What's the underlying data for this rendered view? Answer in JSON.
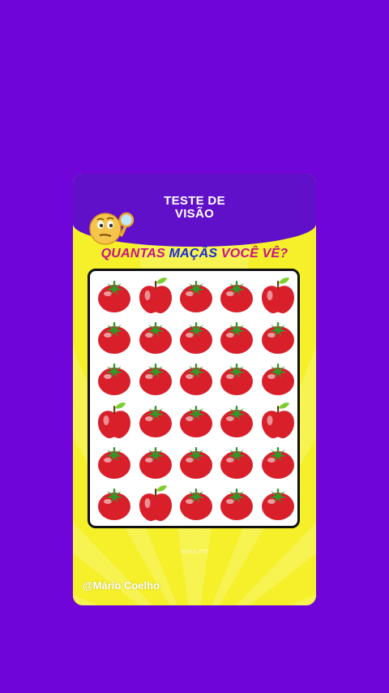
{
  "header": {
    "line1": "TESTE DE",
    "line2": "VISÃO"
  },
  "question": {
    "part1": "QUANTAS ",
    "part2": "MAÇÃS",
    "part3": " VOCÊ VÊ?"
  },
  "grid": {
    "rows": [
      [
        "tomato",
        "apple",
        "tomato",
        "tomato",
        "apple"
      ],
      [
        "tomato",
        "tomato",
        "tomato",
        "tomato",
        "tomato"
      ],
      [
        "tomato",
        "tomato",
        "tomato",
        "tomato",
        "tomato"
      ],
      [
        "apple",
        "tomato",
        "tomato",
        "tomato",
        "apple"
      ],
      [
        "tomato",
        "tomato",
        "tomato",
        "tomato",
        "tomato"
      ],
      [
        "tomato",
        "apple",
        "tomato",
        "tomato",
        "tomato"
      ]
    ]
  },
  "watermark": "www.mtr",
  "credit": "@Mário Coelho",
  "colors": {
    "background": "#6f05d9",
    "header": "#6010c8",
    "card": "#f5f02a",
    "fruit_red": "#d81f2a",
    "stem_green": "#2f9a2a",
    "leaf_green": "#7ccf2e"
  },
  "icons": {
    "mascot": "thinking-emoji-with-magnifier-icon"
  }
}
